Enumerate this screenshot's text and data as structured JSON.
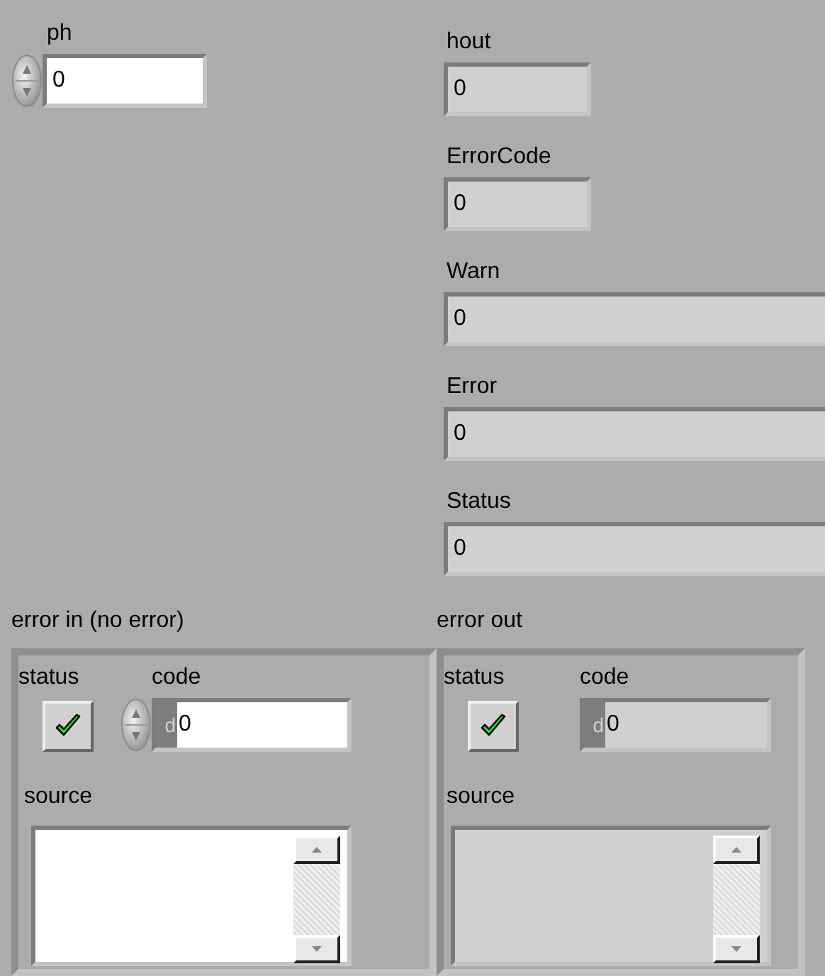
{
  "controls": [
    {
      "label": "ph",
      "value": "0",
      "kind": "control"
    }
  ],
  "indicators": [
    {
      "label": "hout",
      "value": "0",
      "kind": "indicator"
    },
    {
      "label": "ErrorCode",
      "value": "0",
      "kind": "indicator"
    },
    {
      "label": "Warn",
      "value": "0",
      "kind": "indicator"
    },
    {
      "label": "Error",
      "value": "0",
      "kind": "indicator"
    },
    {
      "label": "Status",
      "value": "0",
      "kind": "indicator"
    }
  ],
  "error_clusters": [
    {
      "label": "error in (no error)",
      "kind": "control",
      "status": {
        "label": "status",
        "checked": true
      },
      "code": {
        "label": "code",
        "radix": "d",
        "value": "0"
      },
      "source": {
        "label": "source"
      }
    },
    {
      "label": "error out",
      "kind": "indicator",
      "status": {
        "label": "status",
        "checked": true
      },
      "code": {
        "label": "code",
        "radix": "d",
        "value": "0"
      },
      "source": {
        "label": "source"
      }
    }
  ]
}
